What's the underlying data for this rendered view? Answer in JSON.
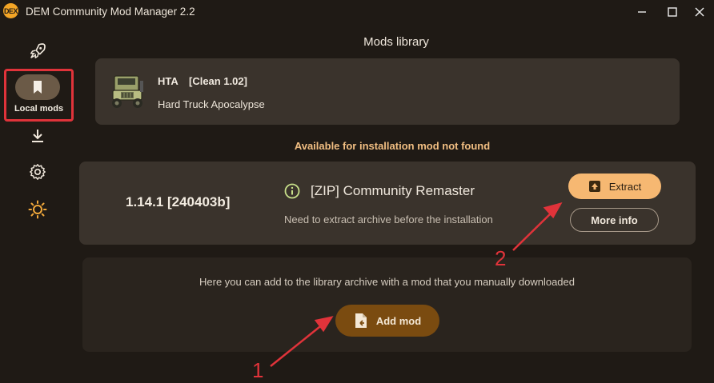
{
  "window": {
    "logo_text": "DEX",
    "title": "DEM Community Mod Manager 2.2",
    "controls": {
      "minimize": "—",
      "maximize": "☐",
      "close": "✕"
    }
  },
  "sidebar": {
    "items": [
      {
        "icon": "rocket-icon",
        "label": ""
      },
      {
        "icon": "bookmark-icon",
        "label": "Local mods",
        "active": true
      },
      {
        "icon": "download-icon",
        "label": ""
      },
      {
        "icon": "gear-icon",
        "label": ""
      },
      {
        "icon": "sun-icon",
        "label": ""
      }
    ]
  },
  "main": {
    "page_title": "Mods library",
    "game": {
      "short_name": "HTA",
      "version": "[Clean 1.02]",
      "full_name": "Hard Truck Apocalypse"
    },
    "notice": "Available for installation mod not found",
    "mod": {
      "version": "1.14.1 [240403b]",
      "name": "[ZIP] Community Remaster",
      "description": "Need to extract archive before the installation",
      "extract_label": "Extract",
      "more_info_label": "More info"
    },
    "add": {
      "text": "Here you can add to the library archive with a mod that you manually downloaded",
      "button_label": "Add mod"
    }
  },
  "annotations": {
    "step_1": "1",
    "step_2": "2"
  },
  "colors": {
    "background": "#1f1a15",
    "card": "#3a332c",
    "accent": "#f6b872",
    "notice": "#f1be82",
    "add_button": "#7a4b10",
    "highlight": "#e0333a"
  }
}
